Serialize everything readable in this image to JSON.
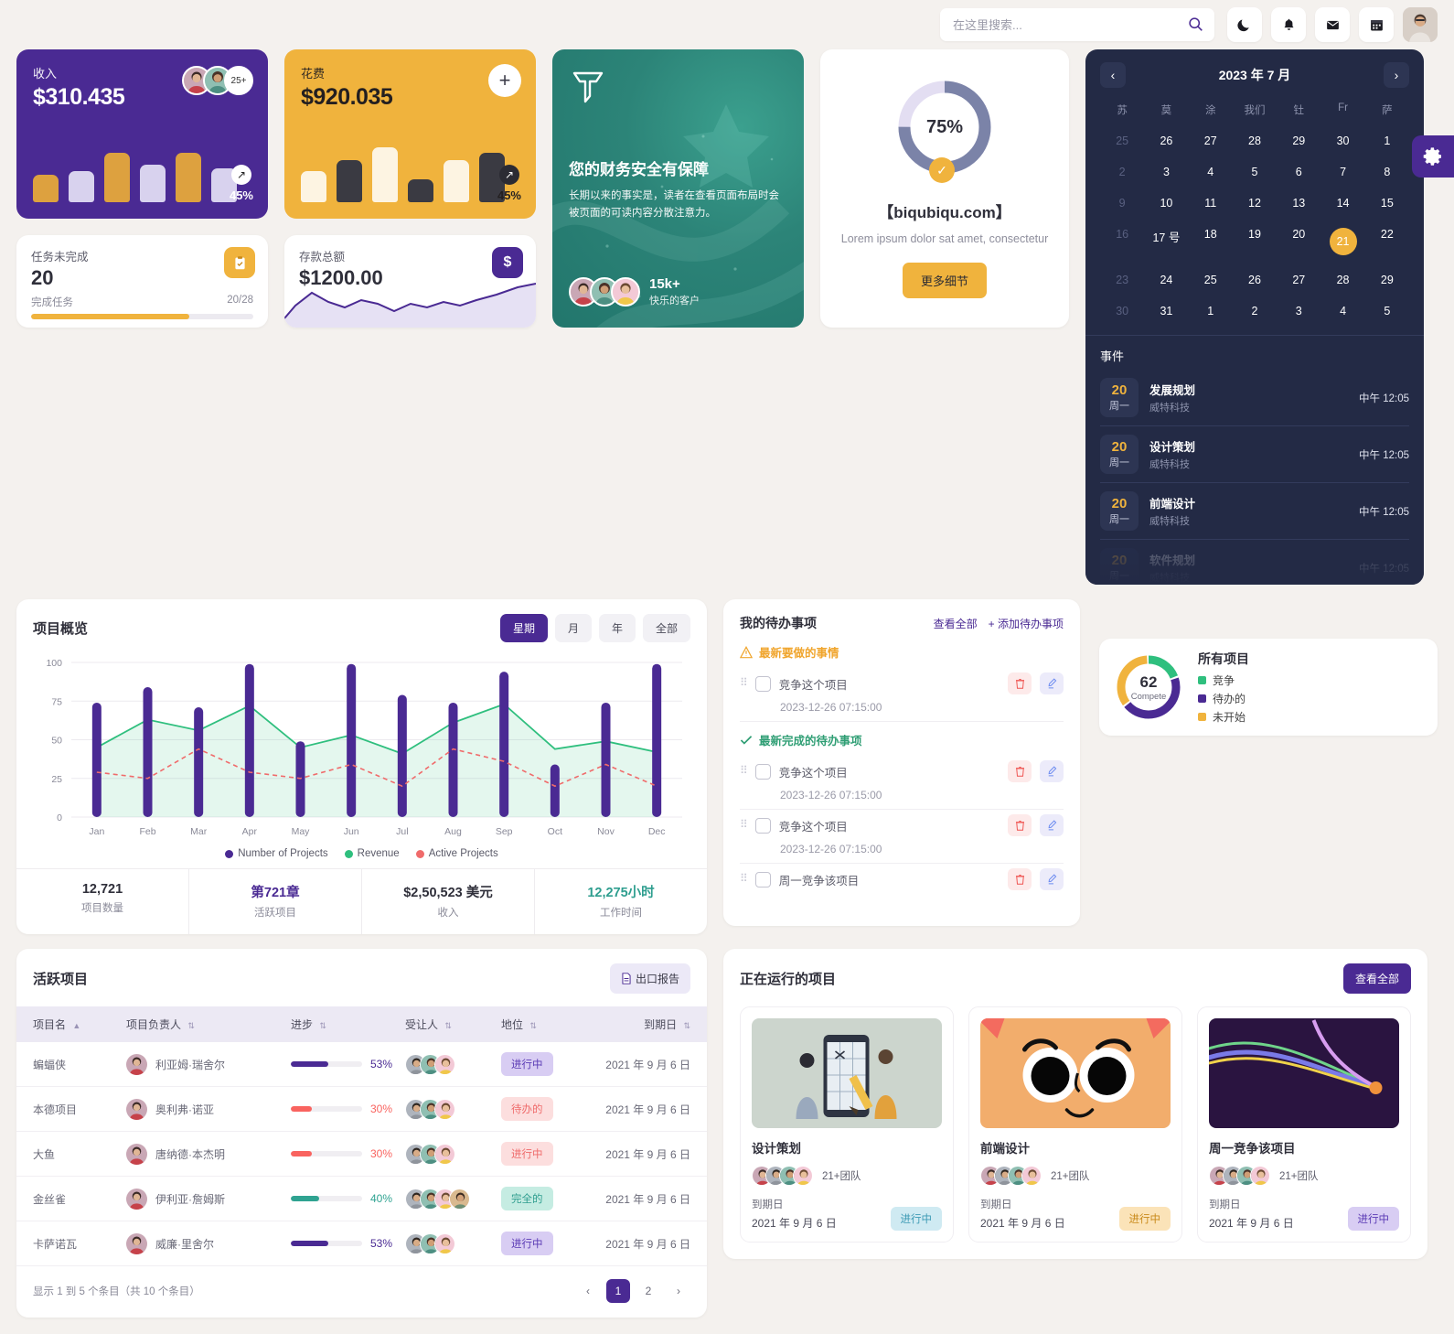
{
  "header": {
    "search_placeholder": "在这里搜索...",
    "icons": [
      "moon-icon",
      "bell-icon",
      "mail-icon",
      "calendar-icon"
    ],
    "avatar": "user-avatar"
  },
  "revenue_card": {
    "label": "收入",
    "value": "$310.435",
    "badge": "25+",
    "trend": "45%",
    "arrow": "↗"
  },
  "expense_card": {
    "label": "花费",
    "value": "$920.035",
    "trend": "45%",
    "arrow": "↗",
    "add": "+"
  },
  "tasks_card": {
    "label": "任务未完成",
    "value": "20",
    "foot_left": "完成任务",
    "foot_right": "20/28",
    "progress": 71
  },
  "deposit_card": {
    "label": "存款总额",
    "value": "$1200.00",
    "icon": "$"
  },
  "promo_card": {
    "title": "您的财务安全有保障",
    "body": "长期以来的事实是，读者在查看页面布局时会被页面的可读内容分散注意力。",
    "count": "15k+",
    "count_sub": "快乐的客户"
  },
  "gauge_card": {
    "percent": "75%",
    "value": 75,
    "title": "【biqubiqu.com】",
    "subtitle": "Lorem ipsum dolor sat amet, consectetur",
    "button": "更多细节"
  },
  "calendar": {
    "title": "2023 年 7 月",
    "prev": "‹",
    "next": "›",
    "dow": [
      "苏",
      "莫",
      "涂",
      "我们",
      "钍",
      "Fr",
      "萨"
    ],
    "weeks": [
      [
        {
          "d": "25",
          "m": true
        },
        {
          "d": "26"
        },
        {
          "d": "27"
        },
        {
          "d": "28"
        },
        {
          "d": "29"
        },
        {
          "d": "30"
        },
        {
          "d": "1"
        }
      ],
      [
        {
          "d": "2",
          "m": true
        },
        {
          "d": "3"
        },
        {
          "d": "4"
        },
        {
          "d": "5"
        },
        {
          "d": "6"
        },
        {
          "d": "7"
        },
        {
          "d": "8"
        }
      ],
      [
        {
          "d": "9",
          "m": true
        },
        {
          "d": "10"
        },
        {
          "d": "11"
        },
        {
          "d": "12"
        },
        {
          "d": "13"
        },
        {
          "d": "14"
        },
        {
          "d": "15"
        }
      ],
      [
        {
          "d": "16",
          "m": true
        },
        {
          "d": "17 号"
        },
        {
          "d": "18"
        },
        {
          "d": "19"
        },
        {
          "d": "20"
        },
        {
          "d": "21",
          "sel": true
        },
        {
          "d": "22"
        }
      ],
      [
        {
          "d": "23",
          "m": true
        },
        {
          "d": "24"
        },
        {
          "d": "25"
        },
        {
          "d": "26"
        },
        {
          "d": "27"
        },
        {
          "d": "28"
        },
        {
          "d": "29"
        }
      ],
      [
        {
          "d": "30",
          "m": true
        },
        {
          "d": "31"
        },
        {
          "d": "1"
        },
        {
          "d": "2"
        },
        {
          "d": "3"
        },
        {
          "d": "4"
        },
        {
          "d": "5"
        }
      ]
    ],
    "events_title": "事件",
    "events": [
      {
        "day": "20",
        "weekday": "周一",
        "name": "发展规划",
        "company": "威特科技",
        "time": "中午 12:05"
      },
      {
        "day": "20",
        "weekday": "周一",
        "name": "设计策划",
        "company": "威特科技",
        "time": "中午 12:05"
      },
      {
        "day": "20",
        "weekday": "周一",
        "name": "前端设计",
        "company": "威特科技",
        "time": "中午 12:05"
      },
      {
        "day": "20",
        "weekday": "周一",
        "name": "软件规划",
        "company": "威特科技",
        "time": "中午 12:05"
      }
    ]
  },
  "donut_card": {
    "center_number": "62",
    "center_label": "Compete",
    "title": "所有项目",
    "legend": [
      {
        "label": "竞争",
        "color": "#2fbf7e",
        "value": 20
      },
      {
        "label": "待办的",
        "color": "#4a2a93",
        "value": 45
      },
      {
        "label": "未开始",
        "color": "#f0b33d",
        "value": 35
      }
    ]
  },
  "overview": {
    "title": "项目概览",
    "segments": [
      {
        "label": "星期",
        "active": true
      },
      {
        "label": "月",
        "active": false
      },
      {
        "label": "年",
        "active": false
      },
      {
        "label": "全部",
        "active": false
      }
    ],
    "stats": [
      {
        "value": "12,721",
        "label": "项目数量",
        "color": "#2f2f3a"
      },
      {
        "value": "第721章",
        "label": "活跃项目",
        "color": "#4a2a93"
      },
      {
        "value": "$2,50,523 美元",
        "label": "收入",
        "color": "#2f2f3a"
      },
      {
        "value": "12,275小时",
        "label": "工作时间",
        "color": "#2f9e8f"
      }
    ]
  },
  "chart_data": {
    "type": "bar",
    "title": "项目概览",
    "xlabel": "",
    "ylabel": "",
    "ylim": [
      0,
      100
    ],
    "yticks": [
      0,
      25,
      50,
      75,
      100
    ],
    "grid": true,
    "legend_position": "bottom",
    "categories": [
      "Jan",
      "Feb",
      "Mar",
      "Apr",
      "May",
      "Jun",
      "Jul",
      "Aug",
      "Sep",
      "Oct",
      "Nov",
      "Dec"
    ],
    "series": [
      {
        "name": "Number of Projects",
        "type": "bar",
        "color": "#4a2a93",
        "values": [
          74,
          84,
          71,
          99,
          49,
          99,
          79,
          74,
          94,
          34,
          74,
          99
        ]
      },
      {
        "name": "Revenue",
        "type": "area",
        "color": "#2fbf7e",
        "values": [
          45,
          63,
          56,
          72,
          45,
          53,
          41,
          61,
          73,
          44,
          49,
          42
        ]
      },
      {
        "name": "Active Projects",
        "type": "line-dashed",
        "color": "#f06b6b",
        "values": [
          29,
          25,
          44,
          29,
          25,
          34,
          20,
          44,
          36,
          20,
          34,
          20
        ]
      }
    ]
  },
  "todo": {
    "title": "我的待办事项",
    "view_all": "查看全部",
    "add": "+ 添加待办事项",
    "section_new": "最新要做的事情",
    "section_done": "最新完成的待办事项",
    "items": [
      {
        "text": "竞争这个项目",
        "date": "2023-12-26 07:15:00",
        "section": "new"
      },
      {
        "text": "竞争这个项目",
        "date": "2023-12-26 07:15:00",
        "section": "done"
      },
      {
        "text": "竞争这个项目",
        "date": "2023-12-26 07:15:00",
        "section": ""
      },
      {
        "text": "周一竞争该项目",
        "date": "",
        "section": ""
      }
    ],
    "delete_icon": "trash-icon",
    "edit_icon": "pencil-icon"
  },
  "table": {
    "title": "活跃项目",
    "export": "出口报告",
    "columns": [
      "项目名",
      "项目负责人",
      "进步",
      "受让人",
      "地位",
      "到期日"
    ],
    "rows": [
      {
        "name": "蝙蝠侠",
        "owner": "利亚姆·瑞舍尔",
        "progress": "53%",
        "pct": 53,
        "bar": "#4a2a93",
        "assignees": 3,
        "status": "进行中",
        "status_bg": "#d8cdf3",
        "status_fg": "#5b3bb5",
        "due": "2021 年 9 月 6 日"
      },
      {
        "name": "本德项目",
        "owner": "奥利弗·诺亚",
        "progress": "30%",
        "pct": 30,
        "bar": "#f9635f",
        "assignees": 3,
        "status": "待办的",
        "status_bg": "#fcdede",
        "status_fg": "#ef6b6b",
        "due": "2021 年 9 月 6 日"
      },
      {
        "name": "大鱼",
        "owner": "唐纳德·本杰明",
        "progress": "30%",
        "pct": 30,
        "bar": "#f9635f",
        "assignees": 3,
        "status": "进行中",
        "status_bg": "#fcdede",
        "status_fg": "#ef6b6b",
        "due": "2021 年 9 月 6 日"
      },
      {
        "name": "金丝雀",
        "owner": "伊利亚·詹姆斯",
        "progress": "40%",
        "pct": 40,
        "bar": "#2fa391",
        "assignees": 4,
        "status": "完全的",
        "status_bg": "#c5ece2",
        "status_fg": "#2f9e8f",
        "due": "2021 年 9 月 6 日"
      },
      {
        "name": "卡萨诺瓦",
        "owner": "威廉·里舍尔",
        "progress": "53%",
        "pct": 53,
        "bar": "#4a2a93",
        "assignees": 3,
        "status": "进行中",
        "status_bg": "#d8cdf3",
        "status_fg": "#5b3bb5",
        "due": "2021 年 9 月 6 日"
      }
    ],
    "footer": "显示 1 到 5 个条目（共 10 个条目）",
    "pages": [
      "1",
      "2"
    ],
    "current_page": "1"
  },
  "running": {
    "title": "正在运行的项目",
    "view_all": "查看全部",
    "cards": [
      {
        "name": "设计策划",
        "team": "21+团队",
        "due_label": "到期日",
        "due": "2021 年 9 月 6 日",
        "status": "进行中",
        "status_bg": "#cfeaf2",
        "status_fg": "#3e9bb5",
        "thumb": "design-illustration"
      },
      {
        "name": "前端设计",
        "team": "21+团队",
        "due_label": "到期日",
        "due": "2021 年 9 月 6 日",
        "status": "进行中",
        "status_bg": "#fbe3b8",
        "status_fg": "#c98a1a",
        "thumb": "character-illustration"
      },
      {
        "name": "周一竞争该项目",
        "team": "21+团队",
        "due_label": "到期日",
        "due": "2021 年 9 月 6 日",
        "status": "进行中",
        "status_bg": "#d8cdf3",
        "status_fg": "#5b3bb5",
        "thumb": "abstract-lines"
      }
    ]
  },
  "settings_tab": {
    "icon": "gear-icon"
  },
  "colors": {
    "purple": "#4a2a93",
    "amber": "#f0b33d",
    "teal": "#2c8478",
    "green": "#2fbf7e",
    "red": "#f06b6b",
    "dark": "#232a45",
    "bg": "#f4f1ee"
  }
}
